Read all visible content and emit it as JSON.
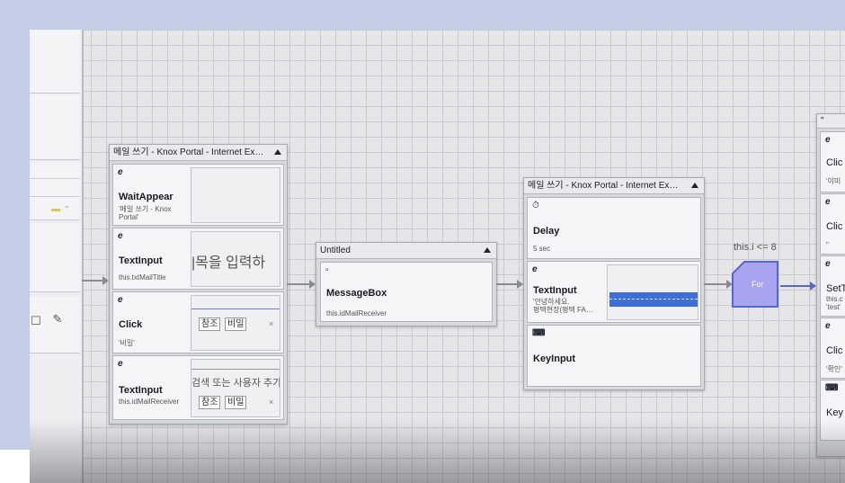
{
  "left_panel": {
    "mini_text": "\""
  },
  "group1": {
    "title": "메일 쓰기 - Knox Portal - Internet Ex…",
    "nodes": [
      {
        "icon": "e",
        "name": "WaitAppear",
        "param": "'메일 쓰기 - Knox Portal'"
      },
      {
        "icon": "e",
        "name": "TextInput",
        "param": "this.txtMailTitle",
        "thumb_text": "|목을 입력하"
      },
      {
        "icon": "e",
        "name": "Click",
        "param": "'비밀'",
        "thumb_btn1": "참조",
        "thumb_btn2": "비밀"
      },
      {
        "icon": "e",
        "name": "TextInput",
        "param": "this.idMailReceiver",
        "thumb_text": "검색 또는 사용자 추가",
        "thumb_btn1": "참조",
        "thumb_btn2": "비밀"
      }
    ]
  },
  "group2": {
    "title": "Untitled",
    "nodes": [
      {
        "icon": "▫",
        "name": "MessageBox",
        "param": "this.idMailReceiver"
      }
    ]
  },
  "group3": {
    "title": "메일 쓰기 - Knox Portal - Internet Ex…",
    "nodes": [
      {
        "icon": "⏱",
        "name": "Delay",
        "param": "5 sec"
      },
      {
        "icon": "e",
        "name": "TextInput",
        "param": "'안녕하세요.",
        "param2": "평택현장(평택 FA…"
      },
      {
        "icon": "⌨",
        "name": "KeyInput",
        "param": ""
      }
    ]
  },
  "loop": {
    "condition": "this.i <= 8",
    "label": "For"
  },
  "group4": {
    "title": "\"",
    "nodes": [
      {
        "icon": "e",
        "name": "Clic",
        "param": "'이미"
      },
      {
        "icon": "e",
        "name": "Clic",
        "param": "\""
      },
      {
        "icon": "e",
        "name": "SetT",
        "param": "this.c",
        "param2": "'test'"
      },
      {
        "icon": "e",
        "name": "Clic",
        "param": "'확인'"
      },
      {
        "icon": "⌨",
        "name": "Key",
        "param": ""
      }
    ]
  },
  "colors": {
    "accent": "#5866c9",
    "for_node": "#a9a4f0",
    "selection": "#3f6fd6"
  }
}
